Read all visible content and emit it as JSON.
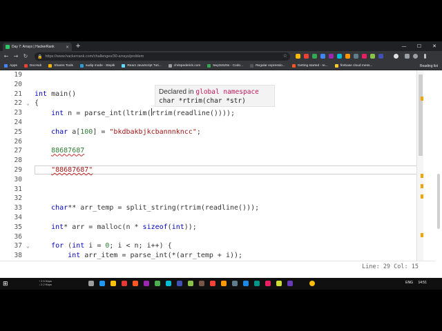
{
  "browser": {
    "tab_title": "Day 7: Arrays | HackerRank",
    "tab_close": "×",
    "new_tab": "+",
    "window_buttons": [
      "—",
      "☐",
      "✕"
    ],
    "back": "←",
    "forward": "→",
    "reload": "↻",
    "url": "https://www.hackerrank.com/challenges/30-arrays/problem",
    "bookmarks": [
      {
        "label": "Apps",
        "color": "#4285f4"
      },
      {
        "label": "DocHub",
        "color": "#e94235"
      },
      {
        "label": "Shares Tools",
        "color": "#f4b400"
      },
      {
        "label": "sudip mode - Stepik",
        "color": "#2d9cdb"
      },
      {
        "label": "React JavaScript Tuti...",
        "color": "#61dafb"
      },
      {
        "label": "chrispederick.com",
        "color": "#9e9e9e"
      },
      {
        "label": "5wy3o5z5s - Codo...",
        "color": "#34a853"
      },
      {
        "label": "Regular expressio...",
        "color": "#555555"
      },
      {
        "label": "Getting started - re...",
        "color": "#ff5722"
      },
      {
        "label": "firebase cloud mess...",
        "color": "#ffca28"
      }
    ],
    "reading_list": "Reading list"
  },
  "editor": {
    "lines": [
      {
        "n": "19",
        "html": ""
      },
      {
        "n": "20",
        "html": ""
      },
      {
        "n": "21",
        "html": "<span class='kw'>int</span> main()"
      },
      {
        "n": "22",
        "html": "{",
        "fold": true
      },
      {
        "n": "23",
        "html": "    <span class='kw'>int</span> n = parse_int(ltrim(<span class='cursorbar'></span>rtrim(readline())));"
      },
      {
        "n": "24",
        "html": ""
      },
      {
        "n": "25",
        "html": "    <span class='kw'>char</span> a[<span class='num'>100</span>] = <span class='str'>\"bkdbakbjkcbannnkncc\"</span>;"
      },
      {
        "n": "26",
        "html": ""
      },
      {
        "n": "27",
        "html": "    <span class='num squig'>88687687</span>"
      },
      {
        "n": "28",
        "html": ""
      },
      {
        "n": "29",
        "html": "    <span class='str squig'>\"88687687\"</span>",
        "active": true
      },
      {
        "n": "30",
        "html": ""
      },
      {
        "n": "31",
        "html": ""
      },
      {
        "n": "32",
        "html": ""
      },
      {
        "n": "33",
        "html": "    <span class='kw'>char</span>** arr_temp = split_string(rtrim(readline()));"
      },
      {
        "n": "34",
        "html": ""
      },
      {
        "n": "35",
        "html": "    <span class='kw'>int</span>* arr = malloc(n * <span class='kw'>sizeof</span>(<span class='kw'>int</span>));"
      },
      {
        "n": "36",
        "html": ""
      },
      {
        "n": "37",
        "html": "    <span class='kw'>for</span> (<span class='kw'>int</span> i = <span class='num'>0</span>; i &lt; n; i++) {",
        "fold": true
      },
      {
        "n": "38",
        "html": "        <span class='kw'>int</span> arr_item = parse_int(*(arr_temp + i));"
      }
    ],
    "status": "Line: 29 Col: 15"
  },
  "tooltip": {
    "declared": "Declared in",
    "namespace": "global namespace",
    "signature": "char *rtrim(char *str)"
  },
  "taskbar": {
    "net_up": "↑ 2.5 Kbps",
    "net_down": "↓ 2.2 Kbps",
    "lang": "ENG",
    "time": "14:51"
  }
}
